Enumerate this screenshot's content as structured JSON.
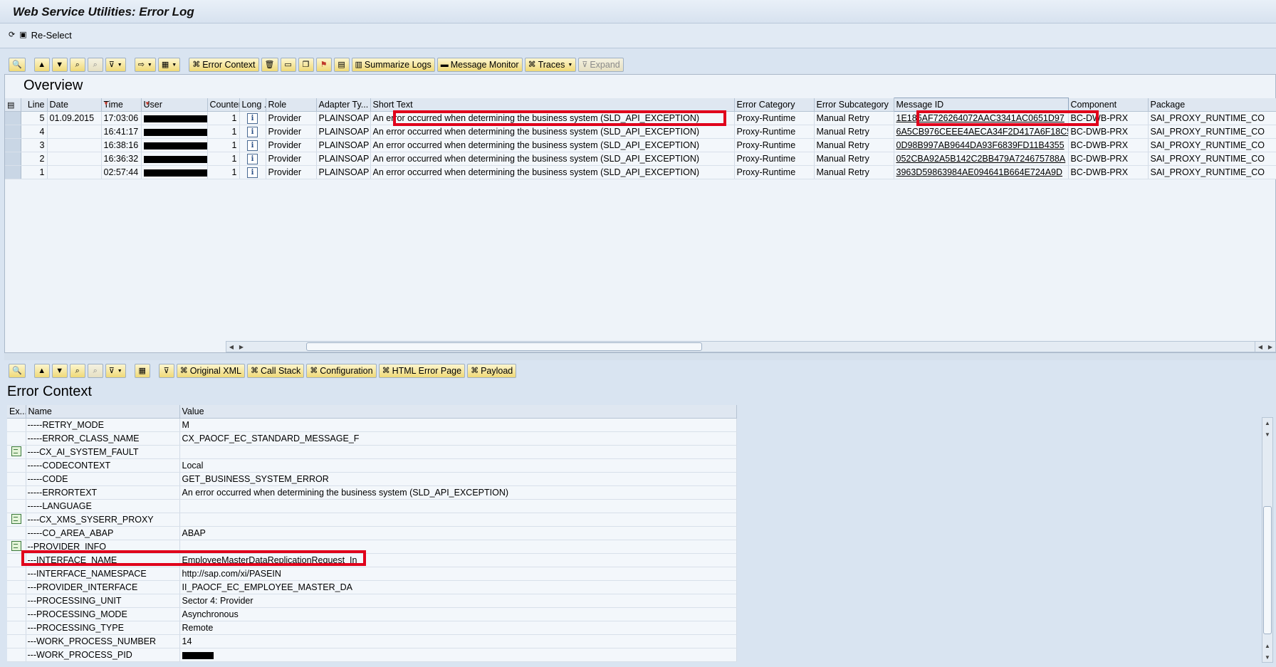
{
  "window": {
    "title": "Web Service Utilities: Error Log"
  },
  "app_toolbar": {
    "reselect_label": "Re-Select"
  },
  "overview": {
    "title": "Overview",
    "toolbar": {
      "error_context": "Error Context",
      "summarize_logs": "Summarize Logs",
      "message_monitor": "Message Monitor",
      "traces": "Traces",
      "expand": "Expand"
    },
    "columns": [
      "Line",
      "Date",
      "Time",
      "User",
      "Counter",
      "Long ...",
      "Role",
      "Adapter Ty...",
      "Short Text",
      "Error Category",
      "Error Subcategory",
      "Message ID",
      "Component",
      "Package"
    ],
    "rows": [
      {
        "line": "5",
        "date": "01.09.2015",
        "time": "17:03:06",
        "counter": "1",
        "role": "Provider",
        "adapter": "PLAINSOAP",
        "short_text": "An error occurred when determining the business system (SLD_API_EXCEPTION)",
        "category": "Proxy-Runtime",
        "subcategory": "Manual Retry",
        "message_id": "1E185AF726264072AAC3341AC0651D97",
        "component": "BC-DWB-PRX",
        "package": "SAI_PROXY_RUNTIME_CO"
      },
      {
        "line": "4",
        "date": "",
        "time": "16:41:17",
        "counter": "1",
        "role": "Provider",
        "adapter": "PLAINSOAP",
        "short_text": "An error occurred when determining the business system (SLD_API_EXCEPTION)",
        "category": "Proxy-Runtime",
        "subcategory": "Manual Retry",
        "message_id": "6A5CB976CEEE4AECA34F2D417A6F18C5",
        "component": "BC-DWB-PRX",
        "package": "SAI_PROXY_RUNTIME_CO"
      },
      {
        "line": "3",
        "date": "",
        "time": "16:38:16",
        "counter": "1",
        "role": "Provider",
        "adapter": "PLAINSOAP",
        "short_text": "An error occurred when determining the business system (SLD_API_EXCEPTION)",
        "category": "Proxy-Runtime",
        "subcategory": "Manual Retry",
        "message_id": "0D98B997AB9644DA93F6839FD11B4355",
        "component": "BC-DWB-PRX",
        "package": "SAI_PROXY_RUNTIME_CO"
      },
      {
        "line": "2",
        "date": "",
        "time": "16:36:32",
        "counter": "1",
        "role": "Provider",
        "adapter": "PLAINSOAP",
        "short_text": "An error occurred when determining the business system (SLD_API_EXCEPTION)",
        "category": "Proxy-Runtime",
        "subcategory": "Manual Retry",
        "message_id": "052CBA92A5B142C2BB479A724675788A",
        "component": "BC-DWB-PRX",
        "package": "SAI_PROXY_RUNTIME_CO"
      },
      {
        "line": "1",
        "date": "",
        "time": "02:57:44",
        "counter": "1",
        "role": "Provider",
        "adapter": "PLAINSOAP",
        "short_text": "An error occurred when determining the business system (SLD_API_EXCEPTION)",
        "category": "Proxy-Runtime",
        "subcategory": "Manual Retry",
        "message_id": "3963D59863984AE094641B664E724A9D",
        "component": "BC-DWB-PRX",
        "package": "SAI_PROXY_RUNTIME_CO"
      }
    ]
  },
  "error_context": {
    "title": "Error Context",
    "toolbar": {
      "original_xml": "Original XML",
      "call_stack": "Call Stack",
      "configuration": "Configuration",
      "html_error_page": "HTML Error Page",
      "payload": "Payload"
    },
    "columns": [
      "Ex...",
      "Name",
      "Value"
    ],
    "rows": [
      {
        "node": false,
        "name": "-----RETRY_MODE",
        "value": "M"
      },
      {
        "node": false,
        "name": "-----ERROR_CLASS_NAME",
        "value": "CX_PAOCF_EC_STANDARD_MESSAGE_F"
      },
      {
        "node": true,
        "name": "----CX_AI_SYSTEM_FAULT",
        "value": ""
      },
      {
        "node": false,
        "name": "-----CODECONTEXT",
        "value": "Local"
      },
      {
        "node": false,
        "name": "-----CODE",
        "value": "GET_BUSINESS_SYSTEM_ERROR"
      },
      {
        "node": false,
        "name": "-----ERRORTEXT",
        "value": "An error occurred when determining the business system (SLD_API_EXCEPTION)"
      },
      {
        "node": false,
        "name": "-----LANGUAGE",
        "value": ""
      },
      {
        "node": true,
        "name": "----CX_XMS_SYSERR_PROXY",
        "value": ""
      },
      {
        "node": false,
        "name": "-----CO_AREA_ABAP",
        "value": "ABAP"
      },
      {
        "node": true,
        "name": "--PROVIDER_INFO",
        "value": ""
      },
      {
        "node": false,
        "name": "---INTERFACE_NAME",
        "value": "EmployeeMasterDataReplicationRequest_In"
      },
      {
        "node": false,
        "name": "---INTERFACE_NAMESPACE",
        "value": "http://sap.com/xi/PASEIN"
      },
      {
        "node": false,
        "name": "---PROVIDER_INTERFACE",
        "value": "II_PAOCF_EC_EMPLOYEE_MASTER_DA"
      },
      {
        "node": false,
        "name": "---PROCESSING_UNIT",
        "value": "Sector 4: Provider"
      },
      {
        "node": false,
        "name": "---PROCESSING_MODE",
        "value": "Asynchronous"
      },
      {
        "node": false,
        "name": "---PROCESSING_TYPE",
        "value": "Remote"
      },
      {
        "node": false,
        "name": "---WORK_PROCESS_NUMBER",
        "value": "14"
      },
      {
        "node": false,
        "name": "---WORK_PROCESS_PID",
        "value": ""
      }
    ]
  },
  "colors": {
    "highlight": "#e0001b",
    "button": "#efd978",
    "background": "#d9e4f1"
  }
}
